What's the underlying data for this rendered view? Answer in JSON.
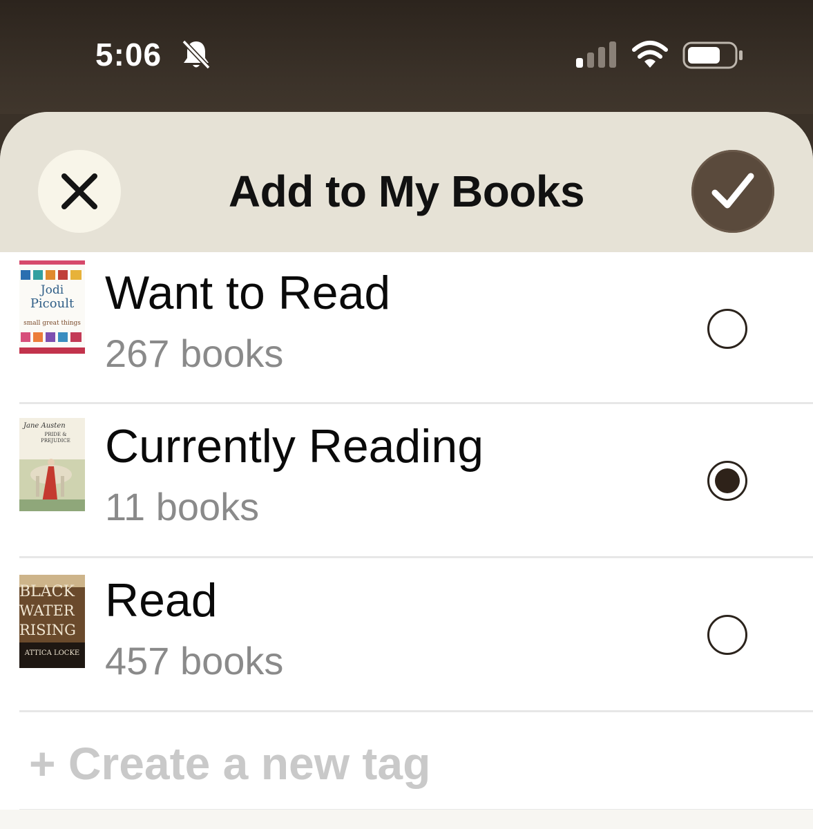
{
  "status_bar": {
    "time": "5:06",
    "icons": [
      "bell-slash-icon",
      "signal-icon",
      "wifi-icon",
      "battery-icon"
    ]
  },
  "sheet": {
    "title": "Add to My Books",
    "close_icon": "close-icon",
    "confirm_icon": "checkmark-icon"
  },
  "shelves": [
    {
      "name": "Want to Read",
      "count": "267 books",
      "selected": false,
      "cover": {
        "author": "Jodi",
        "author2": "Picoult",
        "title": "small great things"
      }
    },
    {
      "name": "Currently Reading",
      "count": "11 books",
      "selected": true,
      "cover": {
        "author": "Jane Austen",
        "title": "PRIDE & PREJUDICE"
      }
    },
    {
      "name": "Read",
      "count": "457 books",
      "selected": false,
      "cover": {
        "line1": "BLACK",
        "line2": "WATER",
        "line3": "RISING",
        "author": "ATTICA LOCKE"
      }
    }
  ],
  "new_tag": {
    "label": "+ Create a new tag"
  },
  "colors": {
    "header_bg": "#e6e2d6",
    "accent": "#5a4a3c",
    "status_bg": "#3a3128"
  }
}
